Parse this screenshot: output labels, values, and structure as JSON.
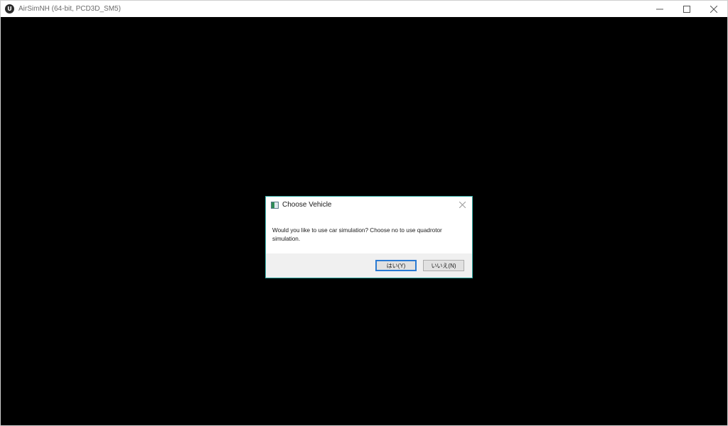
{
  "window": {
    "title": "AirSimNH (64-bit, PCD3D_SM5)",
    "icon_label": "U",
    "controls": [
      "minimize-icon",
      "maximize-icon",
      "close-icon"
    ]
  },
  "dialog": {
    "title": "Choose Vehicle",
    "message": "Would you like to use car simulation? Choose no to use quadrotor simulation.",
    "yes_label": "はい(Y)",
    "no_label": "いいえ(N)",
    "accent_color": "#2b7bd3"
  }
}
